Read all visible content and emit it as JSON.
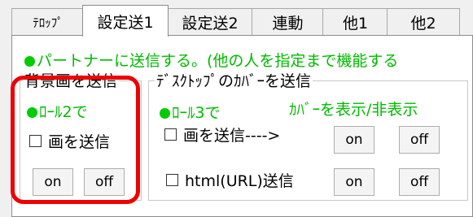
{
  "tabs": [
    {
      "label": "ﾃﾛｯﾌﾟ"
    },
    {
      "label": "設定送1"
    },
    {
      "label": "設定送2"
    },
    {
      "label": "連動"
    },
    {
      "label": "他1"
    },
    {
      "label": "他2"
    }
  ],
  "partner_note": "パートナーに送信する。(他の人を指定まで機能する",
  "background_group": {
    "title": "背景画を送信",
    "role_label": "ﾛｰﾙ2で",
    "send_image_label": "画を送信",
    "send_image_checked": false,
    "on_label": "on",
    "off_label": "off"
  },
  "desktop_group": {
    "title": "ﾃﾞｽｸﾄｯﾌﾟのｶﾊﾞｰを送信",
    "role_label": "ﾛｰﾙ3で",
    "show_hide_label": "ｶﾊﾞｰを表示/非表示",
    "send_image_label": "画を送信---->",
    "send_image_checked": false,
    "html_label": "html(URL)送信",
    "html_checked": false,
    "on_label": "on",
    "off_label": "off"
  },
  "colors": {
    "highlight": "#ee0000",
    "green": "#00bb00"
  }
}
